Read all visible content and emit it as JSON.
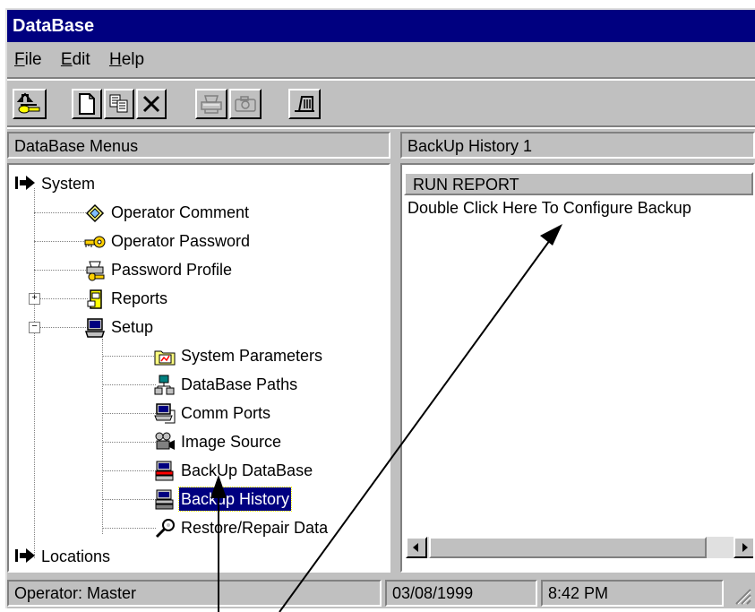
{
  "window": {
    "title": "DataBase"
  },
  "menu": {
    "items": [
      {
        "label": "File",
        "accel": "F",
        "rest": "ile"
      },
      {
        "label": "Edit",
        "accel": "E",
        "rest": "dit"
      },
      {
        "label": "Help",
        "accel": "H",
        "rest": "elp"
      }
    ]
  },
  "toolbar": {
    "buttons": [
      {
        "name": "exit-key-icon",
        "enabled": true
      },
      {
        "name": "new-document-icon",
        "enabled": true
      },
      {
        "name": "copy-icon",
        "enabled": true
      },
      {
        "name": "delete-x-icon",
        "enabled": true
      },
      {
        "name": "print-icon",
        "enabled": false
      },
      {
        "name": "camera-icon",
        "enabled": false
      },
      {
        "name": "exit-door-icon",
        "enabled": true
      }
    ]
  },
  "left_panel": {
    "header": "DataBase Menus",
    "tree": {
      "system": "System",
      "operator_comment": "Operator Comment",
      "operator_password": "Operator Password",
      "password_profile": "Password Profile",
      "reports": "Reports",
      "setup": "Setup",
      "system_parameters": "System Parameters",
      "database_paths": "DataBase Paths",
      "comm_ports": "Comm Ports",
      "image_source": "Image Source",
      "backup_database": "BackUp DataBase",
      "backup_history": "Backup History",
      "restore_repair": "Restore/Repair Data",
      "locations": "Locations"
    },
    "expanders": {
      "reports": "+",
      "setup": "−"
    }
  },
  "right_panel": {
    "header": "BackUp History  1",
    "column_header": "RUN REPORT",
    "row_text": "Double Click Here To Configure Backup"
  },
  "status_bar": {
    "operator": "Operator:  Master",
    "date": "03/08/1999",
    "time": "8:42 PM"
  },
  "colors": {
    "title_bar": "#000080",
    "face": "#c0c0c0",
    "selection": "#000080"
  }
}
